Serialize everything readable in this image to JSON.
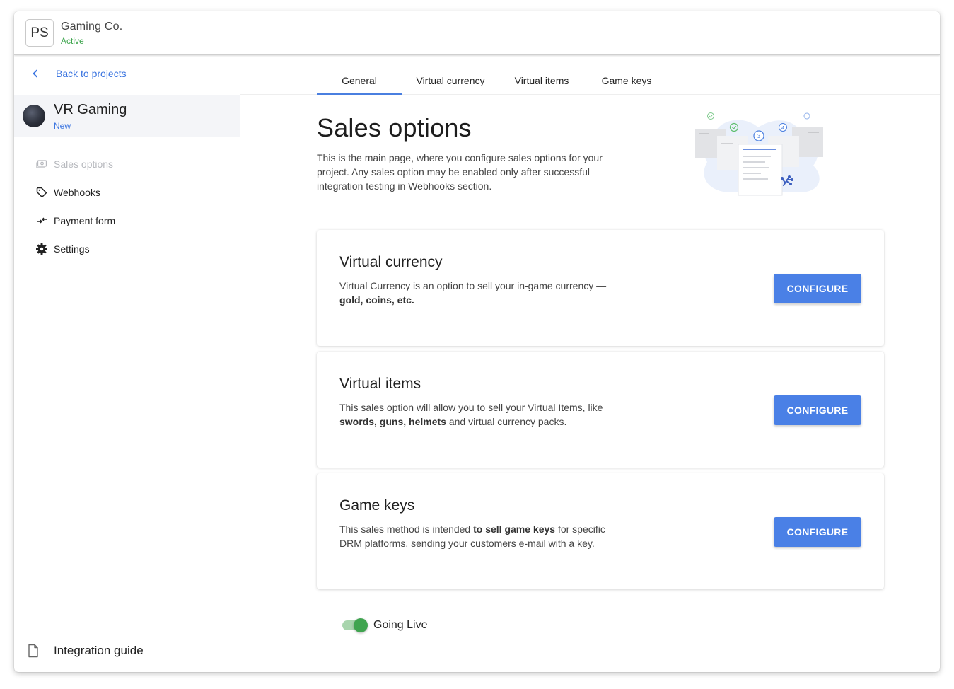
{
  "header": {
    "avatar_initials": "PS",
    "company_name": "Gaming Co.",
    "company_status": "Active"
  },
  "sidebar": {
    "back_label": "Back to projects",
    "project": {
      "name": "VR Gaming",
      "badge": "New"
    },
    "items": [
      {
        "label": "Sales options",
        "icon": "money-icon",
        "disabled": true
      },
      {
        "label": "Webhooks",
        "icon": "tag-icon",
        "disabled": false
      },
      {
        "label": "Payment form",
        "icon": "arrows-icon",
        "disabled": false
      },
      {
        "label": "Settings",
        "icon": "gear-icon",
        "disabled": false
      }
    ],
    "guide_label": "Integration guide"
  },
  "tabs": [
    {
      "label": "General",
      "active": true
    },
    {
      "label": "Virtual currency",
      "active": false
    },
    {
      "label": "Virtual items",
      "active": false
    },
    {
      "label": "Game keys",
      "active": false
    }
  ],
  "main": {
    "title": "Sales options",
    "description": "This is the main page, where you configure sales options for your project. Any sales option may be enabled only after successful integration testing in Webhooks section."
  },
  "cards": [
    {
      "title": "Virtual currency",
      "desc_parts": [
        {
          "text": "Virtual Currency is an option to sell your in-game currency — ",
          "bold": false
        },
        {
          "text": "gold, coins, etc.",
          "bold": true
        }
      ],
      "button": "CONFIGURE"
    },
    {
      "title": "Virtual items",
      "desc_parts": [
        {
          "text": "This sales option will allow you to sell your Virtual Items, like ",
          "bold": false
        },
        {
          "text": "swords, guns, helmets",
          "bold": true
        },
        {
          "text": " and virtual currency packs.",
          "bold": false
        }
      ],
      "button": "CONFIGURE"
    },
    {
      "title": "Game keys",
      "desc_parts": [
        {
          "text": "This sales method is intended ",
          "bold": false
        },
        {
          "text": "to sell game keys",
          "bold": true
        },
        {
          "text": " for specific DRM platforms, sending your customers e-mail with a key.",
          "bold": false
        }
      ],
      "button": "CONFIGURE"
    }
  ],
  "going_live": {
    "label": "Going Live",
    "enabled": true
  },
  "colors": {
    "accent": "#4a80e6",
    "active_green": "#3aa34a",
    "link_blue": "#3a74e0"
  },
  "illustration": {
    "step_number": "3",
    "step_number_right": "4"
  }
}
